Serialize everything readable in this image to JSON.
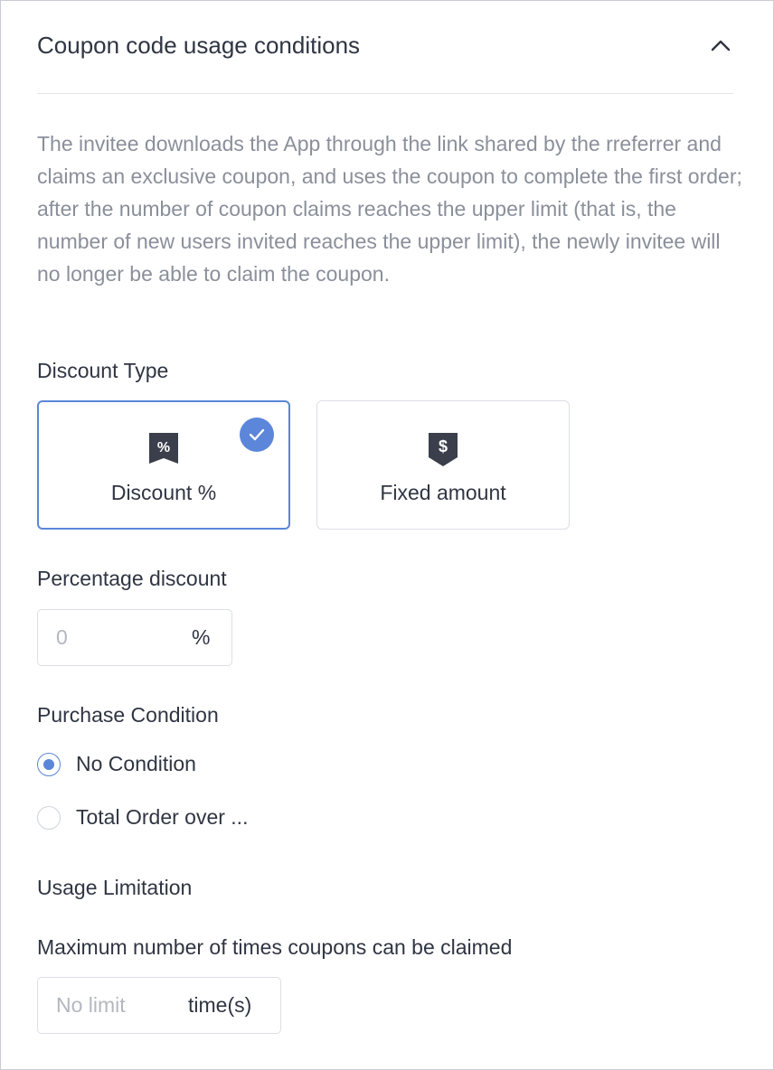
{
  "section": {
    "title": "Coupon code usage conditions",
    "collapse_icon": "chevron-up-icon",
    "description": "The invitee downloads the App through the link shared by the rreferrer and claims an exclusive coupon, and uses the coupon to complete the first order; after the number of coupon claims reaches the upper limit (that is, the number of new users invited reaches the upper limit), the newly invitee will no longer be able to claim the coupon."
  },
  "discount_type": {
    "label": "Discount Type",
    "options": [
      {
        "label": "Discount %",
        "icon": "percent-tag-icon",
        "icon_glyph": "%",
        "selected": true
      },
      {
        "label": "Fixed amount",
        "icon": "dollar-tag-icon",
        "icon_glyph": "$",
        "selected": false
      }
    ]
  },
  "percentage_discount": {
    "label": "Percentage discount",
    "placeholder": "0",
    "value": "",
    "suffix": "%"
  },
  "purchase_condition": {
    "label": "Purchase Condition",
    "options": [
      {
        "label": "No Condition",
        "checked": true
      },
      {
        "label": "Total Order over ...",
        "checked": false
      }
    ]
  },
  "usage_limitation": {
    "label": "Usage Limitation",
    "max_claims_label": "Maximum number of times coupons can be claimed",
    "placeholder": "No limit",
    "value": "",
    "suffix": "time(s)"
  },
  "colors": {
    "accent": "#5b86d9",
    "text": "#2f3542",
    "muted": "#8a8f9a",
    "icon_dark": "#3a3f4b",
    "border": "#dcdfe4"
  }
}
